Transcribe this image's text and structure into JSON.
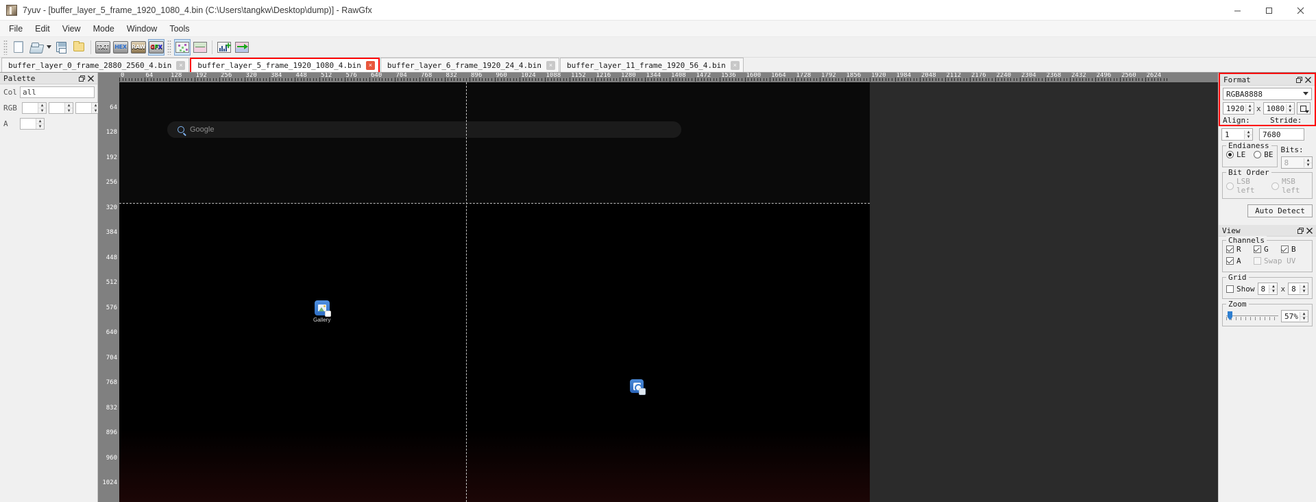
{
  "window": {
    "title": "7yuv - [buffer_layer_5_frame_1920_1080_4.bin (C:\\Users\\tangkw\\Desktop\\dump)] - RawGfx",
    "minimize_label": "minimize-icon",
    "maximize_label": "maximize-icon",
    "close_label": "close-icon"
  },
  "menu": {
    "items": [
      "File",
      "Edit",
      "View",
      "Mode",
      "Window",
      "Tools"
    ]
  },
  "toolbar": {
    "buttons": [
      {
        "name": "new-file-icon",
        "label": "New"
      },
      {
        "name": "open-file-icon",
        "label": "Open"
      },
      {
        "name": "open-dropdown-caret-icon",
        "label": "Open options"
      },
      {
        "name": "save-icon",
        "label": "Save"
      },
      {
        "name": "folder-icon",
        "label": "Folder"
      },
      {
        "name": "view-txt-icon",
        "label": "TXT"
      },
      {
        "name": "view-hex-icon",
        "label": "HEX"
      },
      {
        "name": "view-raw-icon",
        "label": "RAW"
      },
      {
        "name": "view-gfx-icon",
        "label": "GFX"
      },
      {
        "name": "plot-icon",
        "label": "Plot"
      },
      {
        "name": "plot-area-icon",
        "label": "Area plot"
      },
      {
        "name": "histogram-add-icon",
        "label": "Add histogram"
      },
      {
        "name": "export-arrow-icon",
        "label": "Export"
      }
    ]
  },
  "tabs": [
    {
      "label": "buffer_layer_0_frame_2880_2560_4.bin",
      "selected": false,
      "close": "×"
    },
    {
      "label": "buffer_layer_5_frame_1920_1080_4.bin",
      "selected": true,
      "close": "×"
    },
    {
      "label": "buffer_layer_6_frame_1920_24_4.bin",
      "selected": false,
      "close": "×"
    },
    {
      "label": "buffer_layer_11_frame_1920_56_4.bin",
      "selected": false,
      "close": "×"
    }
  ],
  "palette": {
    "title": "Palette",
    "col_label": "Col",
    "col_value": "all",
    "rgb_label": "RGB",
    "rgb_values": [
      "",
      "",
      ""
    ],
    "a_label": "A",
    "a_value": ""
  },
  "rulers": {
    "horizontal": [
      0,
      64,
      128,
      192,
      256,
      320,
      384,
      448,
      512,
      576,
      640,
      704,
      768,
      832,
      896,
      960,
      1024,
      1088,
      1152,
      1216,
      1280,
      1344,
      1408,
      1472,
      1536,
      1600,
      1664,
      1728,
      1792,
      1856,
      1920,
      1984,
      2048,
      2112,
      2176,
      2240,
      2304,
      2368,
      2432,
      2496,
      2560,
      2624
    ],
    "vertical": [
      64,
      128,
      192,
      256,
      320,
      384,
      448,
      512,
      576,
      640,
      704,
      768,
      832,
      896,
      960,
      1024
    ]
  },
  "canvas": {
    "search_placeholder": "Google",
    "search_icon": "search-icon",
    "icons": [
      {
        "name": "gallery-app-icon",
        "label": "Gallery"
      },
      {
        "name": "camera-app-icon",
        "label": ""
      }
    ]
  },
  "format_panel": {
    "title": "Format",
    "pixel_format": "RGBA8888",
    "width": "1920",
    "height": "1080",
    "dim_separator": "x",
    "align_label": "Align:",
    "align_value": "1",
    "stride_label": "Stride:",
    "stride_value": "7680",
    "endianess_legend": "Endianess",
    "endian_options": [
      {
        "label": "LE",
        "selected": true,
        "disabled": false
      },
      {
        "label": "BE",
        "selected": false,
        "disabled": false
      }
    ],
    "bits_label": "Bits:",
    "bits_value": "8",
    "bit_order_legend": "Bit Order",
    "bit_order_options": [
      {
        "label": "LSB left",
        "selected": false,
        "disabled": true
      },
      {
        "label": "MSB left",
        "selected": false,
        "disabled": true
      }
    ],
    "auto_detect_label": "Auto Detect"
  },
  "view_panel": {
    "title": "View",
    "channels_legend": "Channels",
    "channels": [
      {
        "label": "R",
        "checked": true,
        "disabled": false
      },
      {
        "label": "G",
        "checked": true,
        "disabled": false
      },
      {
        "label": "B",
        "checked": true,
        "disabled": false
      },
      {
        "label": "A",
        "checked": true,
        "disabled": false
      },
      {
        "label": "Swap UV",
        "checked": false,
        "disabled": true
      }
    ],
    "grid_legend": "Grid",
    "grid_show_label": "Show",
    "grid_show_checked": false,
    "grid_x": "8",
    "grid_sep": "x",
    "grid_y": "8",
    "zoom_legend": "Zoom",
    "zoom_value": "57%"
  },
  "colors": {
    "accent_red": "#ff0000",
    "panel_bg": "#f0f0f0",
    "canvas_bg": "#2b2b2b",
    "selection_blue": "#cce4f7"
  }
}
